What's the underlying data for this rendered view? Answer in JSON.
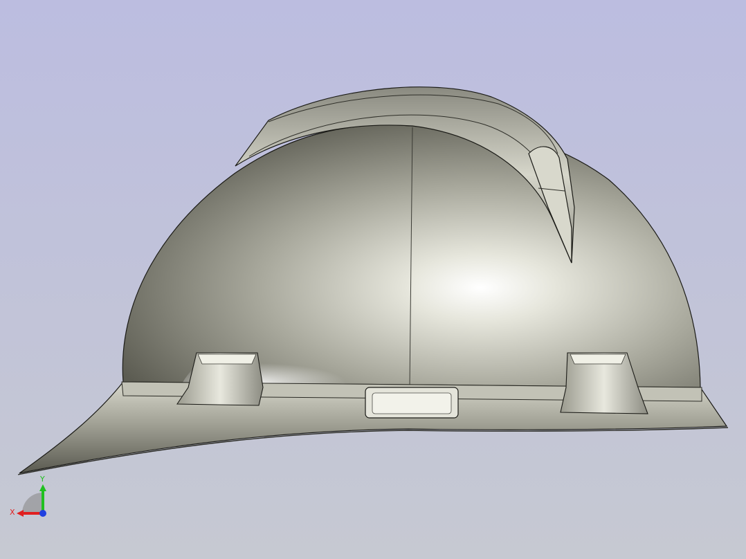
{
  "viewport": {
    "background_top": "#bcbde0",
    "background_bottom": "#c6c9d2",
    "model_name": "hard-hat"
  },
  "triad": {
    "x_label": "X",
    "y_label": "Y",
    "x_color": "#e02020",
    "y_color": "#20c020",
    "z_color": "#2040e0"
  }
}
